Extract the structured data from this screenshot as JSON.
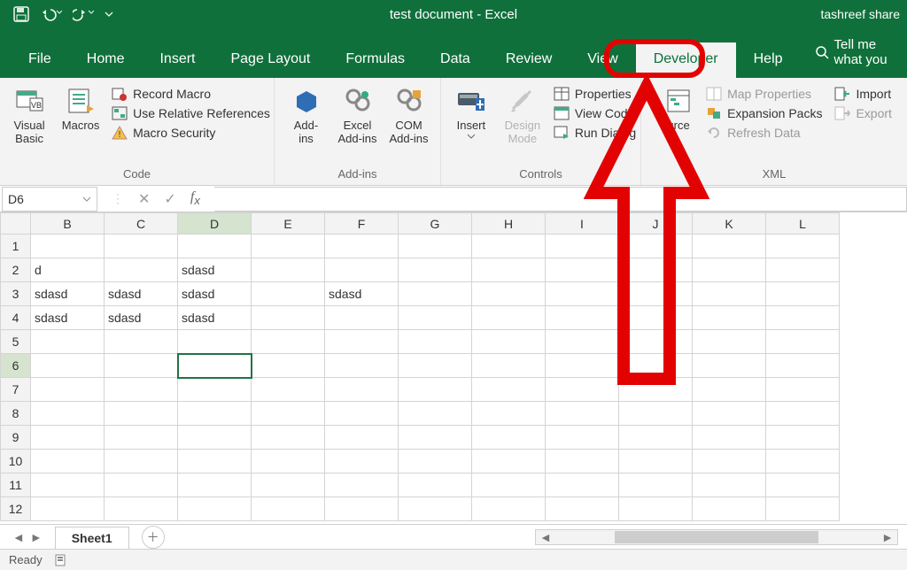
{
  "title": "test document  -  Excel",
  "username": "tashreef share",
  "tabs": [
    "File",
    "Home",
    "Insert",
    "Page Layout",
    "Formulas",
    "Data",
    "Review",
    "View",
    "Developer",
    "Help"
  ],
  "active_tab_index": 8,
  "tell_me": "Tell me what you",
  "ribbon": {
    "code": {
      "visual_basic": "Visual\nBasic",
      "macros": "Macros",
      "record": "Record Macro",
      "relative": "Use Relative References",
      "security": "Macro Security",
      "group": "Code"
    },
    "addins": {
      "addins": "Add-\nins",
      "excel_addins": "Excel\nAdd-ins",
      "com_addins": "COM\nAdd-ins",
      "group": "Add-ins"
    },
    "controls": {
      "insert": "Insert",
      "design": "Design\nMode",
      "properties": "Properties",
      "view_code": "View Code",
      "run_dialog": "Run Dialog",
      "group": "Controls"
    },
    "xml": {
      "source": "urce",
      "map_props": "Map Properties",
      "expansion": "Expansion Packs",
      "refresh": "Refresh Data",
      "import": "Import",
      "export": "Export",
      "group": "XML"
    }
  },
  "namebox": "D6",
  "formula": "",
  "columns": [
    "B",
    "C",
    "D",
    "E",
    "F",
    "G",
    "H",
    "I",
    "J",
    "K",
    "L"
  ],
  "rows": [
    "1",
    "2",
    "3",
    "4",
    "5",
    "6",
    "7",
    "8",
    "9",
    "10",
    "11",
    "12"
  ],
  "cells": {
    "r2": {
      "B": "d",
      "D": "sdasd"
    },
    "r3": {
      "B": "sdasd",
      "C": "sdasd",
      "D": "sdasd",
      "F": "sdasd"
    },
    "r4": {
      "B": "sdasd",
      "C": "sdasd",
      "D": "sdasd"
    }
  },
  "selected_cell": "D6",
  "sheet_tab": "Sheet1",
  "status": "Ready"
}
